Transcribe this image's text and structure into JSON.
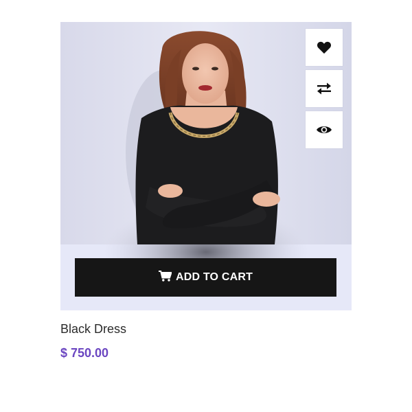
{
  "product": {
    "title": "Black Dress",
    "price": "$ 750.00",
    "image_alt": "woman in black top with gold chain necklace"
  },
  "actions": {
    "add_to_cart_label": "ADD TO CART",
    "add_to_cart_icon": "cart-icon",
    "wishlist_icon": "heart-icon",
    "compare_icon": "compare-arrows-icon",
    "quick_view_icon": "eye-icon"
  },
  "colors": {
    "card_background": "#e3e5f6",
    "button_background": "#161616",
    "price": "#6b46c1",
    "garment": "#1c1c1e"
  }
}
